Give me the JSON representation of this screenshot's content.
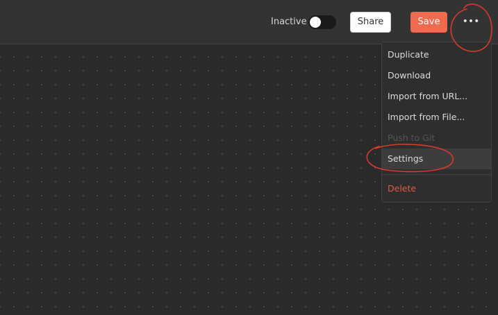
{
  "header": {
    "status_label": "Inactive",
    "share_label": "Share",
    "save_label": "Save",
    "more_label": "•••"
  },
  "menu": {
    "items": [
      {
        "label": "Duplicate"
      },
      {
        "label": "Download"
      },
      {
        "label": "Import from URL..."
      },
      {
        "label": "Import from File..."
      },
      {
        "label": "Push to Git"
      },
      {
        "label": "Settings"
      },
      {
        "label": "Delete"
      }
    ]
  },
  "colors": {
    "accent": "#ef6a4f",
    "danger": "#e25a4a",
    "annotation": "#d93a2b"
  },
  "icons": {
    "more": "more-horizontal-icon"
  }
}
